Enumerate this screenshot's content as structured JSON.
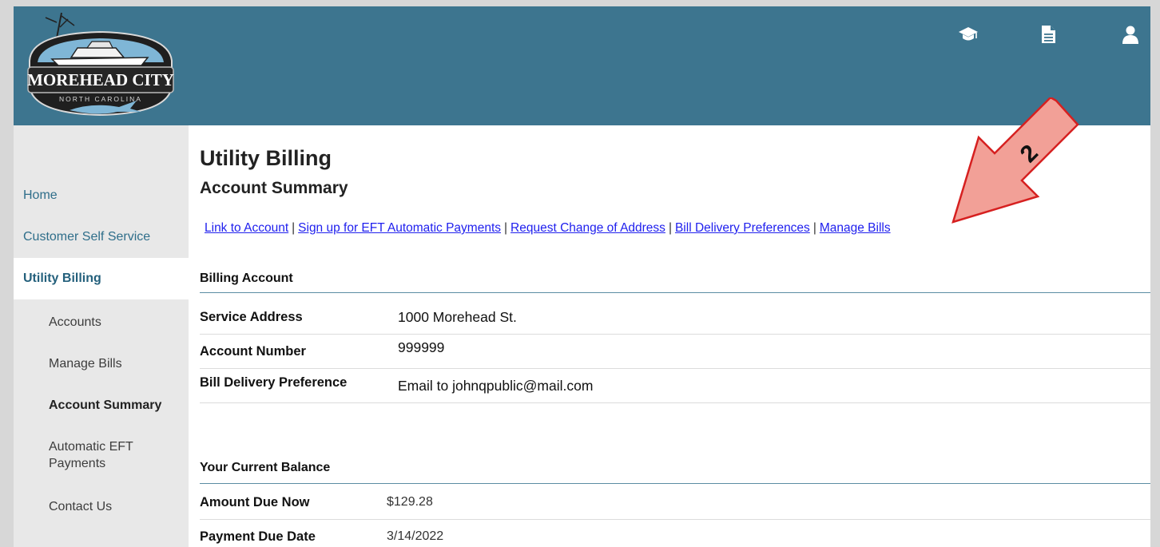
{
  "header": {
    "logo": {
      "title": "MOREHEAD CITY",
      "subtitle": "NORTH CAROLINA"
    },
    "icons": [
      {
        "name": "graduation-cap-icon"
      },
      {
        "name": "document-icon"
      },
      {
        "name": "user-icon"
      }
    ]
  },
  "sidebar": {
    "items": [
      {
        "label": "Home"
      },
      {
        "label": "Customer Self Service"
      },
      {
        "label": "Utility Billing"
      },
      {
        "label": "Accounts"
      },
      {
        "label": "Manage Bills"
      },
      {
        "label": "Account Summary"
      },
      {
        "label": "Automatic EFT Payments"
      },
      {
        "label": "Contact Us"
      }
    ]
  },
  "page": {
    "title": "Utility Billing",
    "subtitle": "Account Summary",
    "links": [
      {
        "label": "Link to Account"
      },
      {
        "label": "Sign up for EFT Automatic Payments"
      },
      {
        "label": "Request Change of Address"
      },
      {
        "label": "Bill Delivery Preferences"
      },
      {
        "label": "Manage Bills"
      }
    ]
  },
  "billing_account": {
    "title": "Billing Account",
    "rows": [
      {
        "label": "Service Address",
        "value": "1000 Morehead St."
      },
      {
        "label": "Account Number",
        "value": "999999"
      },
      {
        "label": "Bill Delivery Preference",
        "value": "Email to johnqpublic@mail.com"
      }
    ]
  },
  "current_balance": {
    "title": "Your Current Balance",
    "rows": [
      {
        "label": "Amount Due Now",
        "value": "$129.28"
      },
      {
        "label": "Payment Due Date",
        "value": "3/14/2022"
      }
    ]
  },
  "annotation": {
    "step": "2",
    "color": "#f2a097"
  },
  "colors": {
    "header": "#3d758f",
    "link": "#2020ee",
    "sidebar": "#e8e8e8"
  }
}
